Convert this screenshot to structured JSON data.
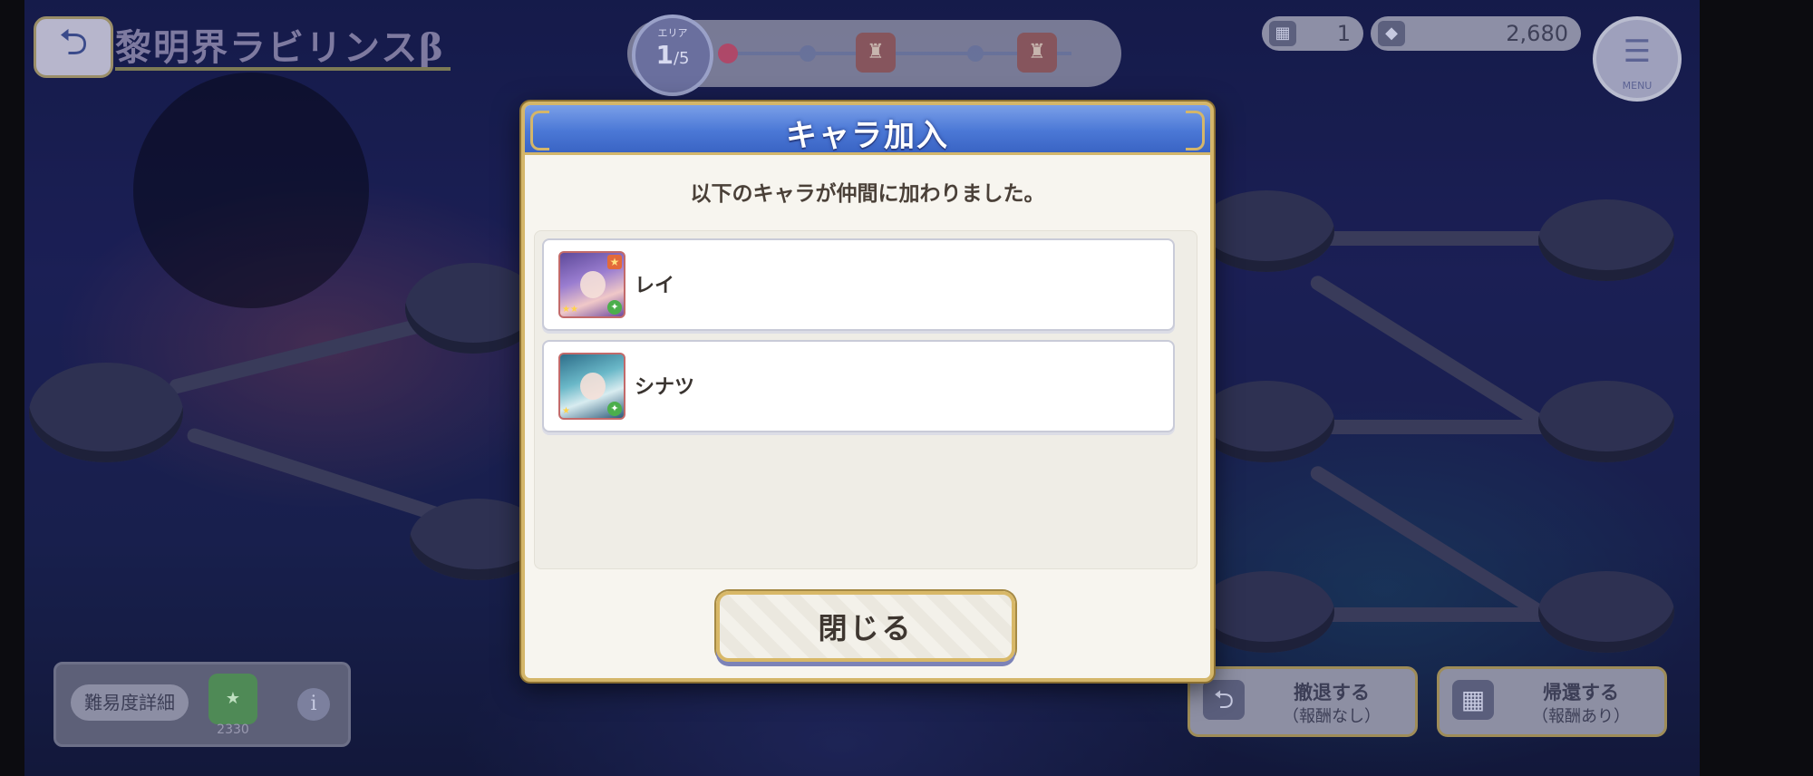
{
  "header": {
    "title": "黎明界ラビリンスβ",
    "back_icon": "back-arrow-icon"
  },
  "progress": {
    "floor_caption": "エリア",
    "floor_current": "1",
    "floor_total": "/5",
    "boss_icon": "boss-icon"
  },
  "resources": {
    "items": [
      {
        "icon": "ticket-icon",
        "value": "1"
      },
      {
        "icon": "gem-icon",
        "value": "2,680"
      }
    ]
  },
  "menu": {
    "label": "MENU",
    "icon": "menu-icon"
  },
  "difficulty": {
    "button_label": "難易度詳細",
    "badge_value": "2330",
    "info_icon": "info-icon"
  },
  "actions": {
    "retreat_no_reward": {
      "line1": "撤退する",
      "line2": "（報酬なし）"
    },
    "retreat_with_reward": {
      "line1": "帰還する",
      "line2": "（報酬あり）"
    }
  },
  "dialog": {
    "title": "キャラ加入",
    "message": "以下のキャラが仲間に加わりました。",
    "characters": [
      {
        "name": "レイ",
        "portrait": "rei-portrait"
      },
      {
        "name": "シナツ",
        "portrait": "shinatsu-portrait"
      }
    ],
    "close_label": "閉じる"
  },
  "colors": {
    "header_blue": "#4b78d6",
    "gold_border": "#d4b66a",
    "panel_bg": "#f7f5ef"
  }
}
